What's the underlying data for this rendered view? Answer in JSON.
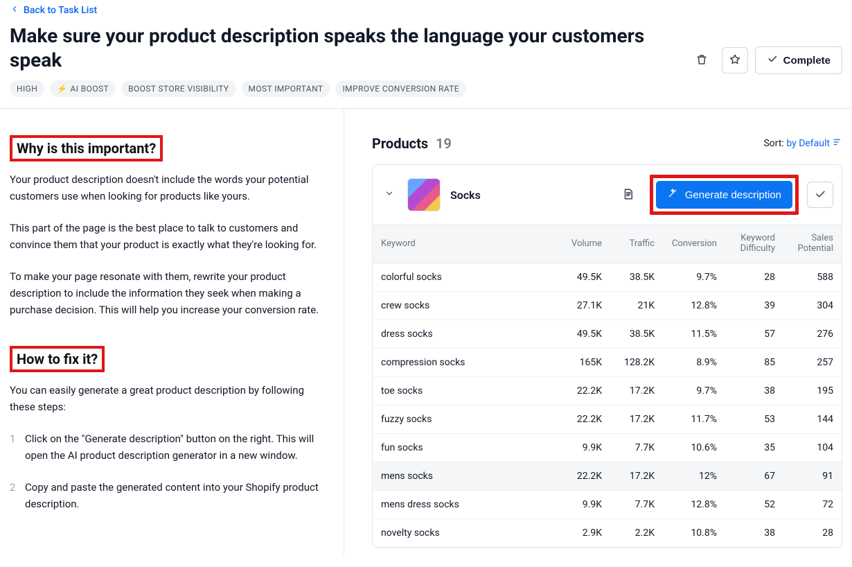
{
  "header": {
    "back_label": "Back to Task List",
    "title": "Make sure your product description speaks the language your customers speak",
    "complete_label": "Complete",
    "tags": [
      {
        "label": "HIGH",
        "boost": false
      },
      {
        "label": "AI BOOST",
        "boost": true
      },
      {
        "label": "BOOST STORE VISIBILITY",
        "boost": false
      },
      {
        "label": "MOST IMPORTANT",
        "boost": false
      },
      {
        "label": "IMPROVE CONVERSION RATE",
        "boost": false
      }
    ]
  },
  "left": {
    "important_title": "Why is this important?",
    "p1": "Your product description doesn't include the words your potential customers use when looking for products like yours.",
    "p2": "This part of the page is the best place to talk to customers and convince them that your product is exactly what they're looking for.",
    "p3": "To make your page resonate with them, rewrite your product description to include the information they seek when making a purchase decision. This will help you increase your conversion rate.",
    "fix_title": "How to fix it?",
    "steps_intro": "You can easily generate a great product description by following these steps:",
    "steps": [
      "Click on the \"Generate description\" button on the right. This will open the AI product description generator in a new window.",
      "Copy and paste the generated content into your Shopify product description."
    ]
  },
  "products": {
    "title": "Products",
    "count": "19",
    "sort_label": "Sort:",
    "sort_value": "by Default",
    "item": {
      "name": "Socks",
      "generate_label": "Generate description"
    },
    "columns": {
      "keyword": "Keyword",
      "volume": "Volume",
      "traffic": "Traffic",
      "conversion": "Conversion",
      "kd1": "Keyword",
      "kd2": "Difficulty",
      "sp1": "Sales",
      "sp2": "Potential"
    },
    "rows": [
      {
        "keyword": "colorful socks",
        "volume": "49.5K",
        "traffic": "38.5K",
        "conversion": "9.7%",
        "kd": "28",
        "sp": "588"
      },
      {
        "keyword": "crew socks",
        "volume": "27.1K",
        "traffic": "21K",
        "conversion": "12.8%",
        "kd": "39",
        "sp": "304"
      },
      {
        "keyword": "dress socks",
        "volume": "49.5K",
        "traffic": "38.5K",
        "conversion": "11.5%",
        "kd": "57",
        "sp": "276"
      },
      {
        "keyword": "compression socks",
        "volume": "165K",
        "traffic": "128.2K",
        "conversion": "8.9%",
        "kd": "85",
        "sp": "257"
      },
      {
        "keyword": "toe socks",
        "volume": "22.2K",
        "traffic": "17.2K",
        "conversion": "9.7%",
        "kd": "38",
        "sp": "195"
      },
      {
        "keyword": "fuzzy socks",
        "volume": "22.2K",
        "traffic": "17.2K",
        "conversion": "11.7%",
        "kd": "53",
        "sp": "144"
      },
      {
        "keyword": "fun socks",
        "volume": "9.9K",
        "traffic": "7.7K",
        "conversion": "10.6%",
        "kd": "35",
        "sp": "104"
      },
      {
        "keyword": "mens socks",
        "volume": "22.2K",
        "traffic": "17.2K",
        "conversion": "12%",
        "kd": "67",
        "sp": "91",
        "hover": true
      },
      {
        "keyword": "mens dress socks",
        "volume": "9.9K",
        "traffic": "7.7K",
        "conversion": "12.8%",
        "kd": "52",
        "sp": "72"
      },
      {
        "keyword": "novelty socks",
        "volume": "2.9K",
        "traffic": "2.2K",
        "conversion": "10.8%",
        "kd": "38",
        "sp": "28"
      }
    ]
  }
}
